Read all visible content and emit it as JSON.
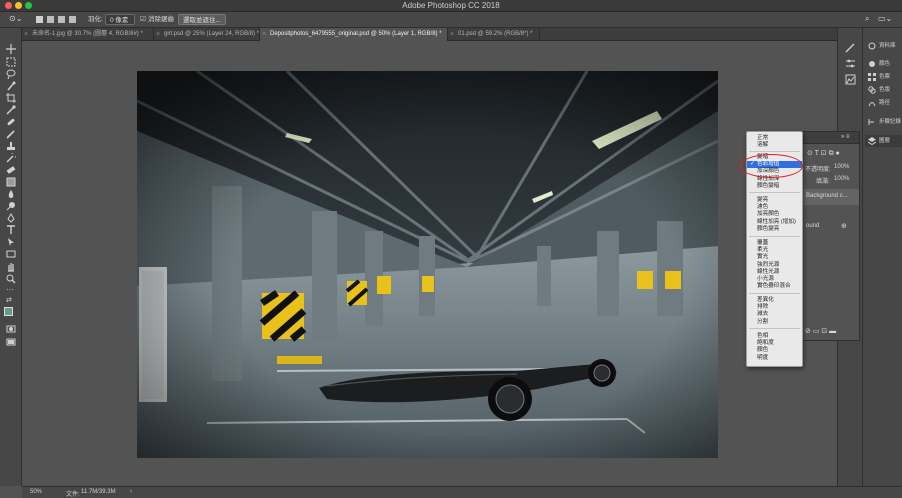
{
  "app": {
    "title": "Adobe Photoshop CC 2018"
  },
  "colors": {
    "accent": "#2f6fe0",
    "annotation": "#e02020",
    "window_close": "#fd5e57",
    "window_min": "#fdbc2e",
    "window_max": "#27c840"
  },
  "options_bar": {
    "feather_label": "羽化:",
    "feather_value": "0 像素",
    "antialias_label": "消除鋸齒",
    "select_mask_button": "選取並遮住..."
  },
  "tabs": [
    {
      "label": "未命名-1.jpg @ 30.7% (圖層 4, RGB/8#) *",
      "active": false
    },
    {
      "label": "girl.psd @ 25% (Layer 24, RGB/8) *",
      "active": false
    },
    {
      "label": "Depositphotos_6479555_original.psd @ 50% (Layer 1, RGB/8) *",
      "active": true
    },
    {
      "label": "01.psd @ 59.2% (RGB/8*) *",
      "active": false
    }
  ],
  "tools": [
    "move-icon",
    "marquee-icon",
    "lasso-icon",
    "quick-select-icon",
    "crop-icon",
    "eyedropper-icon",
    "healing-icon",
    "brush-icon",
    "stamp-icon",
    "history-brush-icon",
    "eraser-icon",
    "gradient-icon",
    "blur-icon",
    "dodge-icon",
    "pen-icon",
    "type-icon",
    "path-select-icon",
    "shape-icon",
    "hand-icon",
    "zoom-icon"
  ],
  "right_panel": {
    "items": [
      {
        "label": "資料庫",
        "icon": "library-icon"
      },
      {
        "label": "顏色",
        "icon": "color-icon"
      },
      {
        "label": "色票",
        "icon": "swatches-icon"
      },
      {
        "label": "色版",
        "icon": "channels-icon"
      },
      {
        "label": "路徑",
        "icon": "paths-icon"
      },
      {
        "label": "步驟記錄",
        "icon": "history-icon"
      },
      {
        "label": "圖層",
        "icon": "layers-icon"
      }
    ]
  },
  "layers_panel": {
    "opacity_label": "不透明度:",
    "opacity_value": "100%",
    "fill_label": "填滿:",
    "fill_value": "100%",
    "layer_names": [
      "Background c...",
      "ound"
    ]
  },
  "blend_menu": {
    "groups": [
      [
        "正常",
        "溶解"
      ],
      [
        "變暗",
        "色彩增值",
        "加深顏色",
        "線性加深",
        "顏色變暗"
      ],
      [
        "變亮",
        "濾色",
        "加亮顏色",
        "線性加亮 (增加)",
        "顏色變亮"
      ],
      [
        "覆蓋",
        "柔光",
        "實光",
        "強烈光源",
        "線性光源",
        "小光源",
        "實色疊印混合"
      ],
      [
        "差異化",
        "排除",
        "減去",
        "分割"
      ],
      [
        "色相",
        "飽和度",
        "顏色",
        "明度"
      ]
    ],
    "selected": "色彩增值"
  },
  "status": {
    "zoom": "50%",
    "doc_label": "文件:",
    "doc_size": "11.7M/39.3M"
  }
}
